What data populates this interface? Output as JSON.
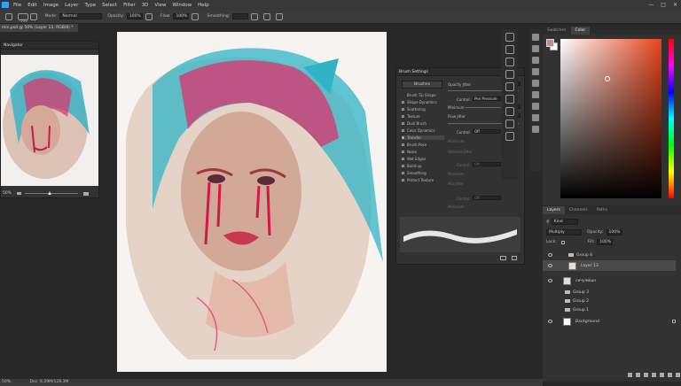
{
  "menu": {
    "items": [
      "File",
      "Edit",
      "Image",
      "Layer",
      "Type",
      "Select",
      "Filter",
      "3D",
      "View",
      "Window",
      "Help"
    ]
  },
  "options": {
    "mode_label": "Mode:",
    "mode_value": "Normal",
    "opacity_label": "Opacity:",
    "opacity_value": "100%",
    "flow_label": "Flow:",
    "flow_value": "100%",
    "smoothing_label": "Smoothing:",
    "brush_size": "100"
  },
  "document": {
    "tab_title": "min.psd @ 50% (Layer 13, RGB/8) *"
  },
  "navigator": {
    "title": "Navigator",
    "zoom": "50%"
  },
  "status": {
    "zoom": "50%",
    "doc_info": "Doc: 6.29M/128.3M"
  },
  "color": {
    "tabs": [
      "Swatches",
      "Color"
    ],
    "fg": "#c7897d",
    "bg": "#ffffff"
  },
  "brush_settings": {
    "title": "Brush Settings",
    "brushes_button": "Brushes",
    "options": [
      {
        "label": "Brush Tip Shape",
        "checked": false,
        "plain": true
      },
      {
        "label": "Shape Dynamics",
        "checked": false
      },
      {
        "label": "Scattering",
        "checked": false
      },
      {
        "label": "Texture",
        "checked": false
      },
      {
        "label": "Dual Brush",
        "checked": false
      },
      {
        "label": "Color Dynamics",
        "checked": false
      },
      {
        "label": "Transfer",
        "checked": true
      },
      {
        "label": "Brush Pose",
        "checked": false
      },
      {
        "label": "Noise",
        "checked": false
      },
      {
        "label": "Wet Edges",
        "checked": false
      },
      {
        "label": "Build-up",
        "checked": false
      },
      {
        "label": "Smoothing",
        "checked": false
      },
      {
        "label": "Protect Texture",
        "checked": false
      }
    ],
    "opacity_jitter_label": "Opacity Jitter",
    "opacity_jitter": "0%",
    "control_label": "Control:",
    "control_pen": "Pen Pressure",
    "minimum_label": "Minimum",
    "minimum": "22%",
    "flow_jitter_label": "Flow Jitter",
    "flow_jitter": "0%",
    "control_off": "Off",
    "minimum2_label": "Minimum",
    "wetness_label": "Wetness Jitter",
    "minimum3_label": "Minimum",
    "mix_label": "Mix Jitter",
    "minimum4_label": "Minimum"
  },
  "layers": {
    "tabs": [
      "Layers",
      "Channels",
      "Paths"
    ],
    "kind": "Kind",
    "blend": "Multiply",
    "opacity_label": "Opacity:",
    "opacity": "100%",
    "lock_label": "Lock:",
    "fill_label": "Fill:",
    "fill": "100%",
    "rows": [
      {
        "name": "Group 4",
        "type": "group",
        "visible": true
      },
      {
        "name": "Layer 13",
        "type": "layer",
        "visible": true,
        "selected": true
      },
      {
        "name": "сичуэйшн",
        "type": "layer",
        "visible": true
      },
      {
        "name": "Group 3",
        "type": "group",
        "visible": false
      },
      {
        "name": "Group 2",
        "type": "group",
        "visible": false
      },
      {
        "name": "Group 1",
        "type": "group",
        "visible": false
      },
      {
        "name": "Background",
        "type": "bg",
        "visible": true
      }
    ]
  }
}
